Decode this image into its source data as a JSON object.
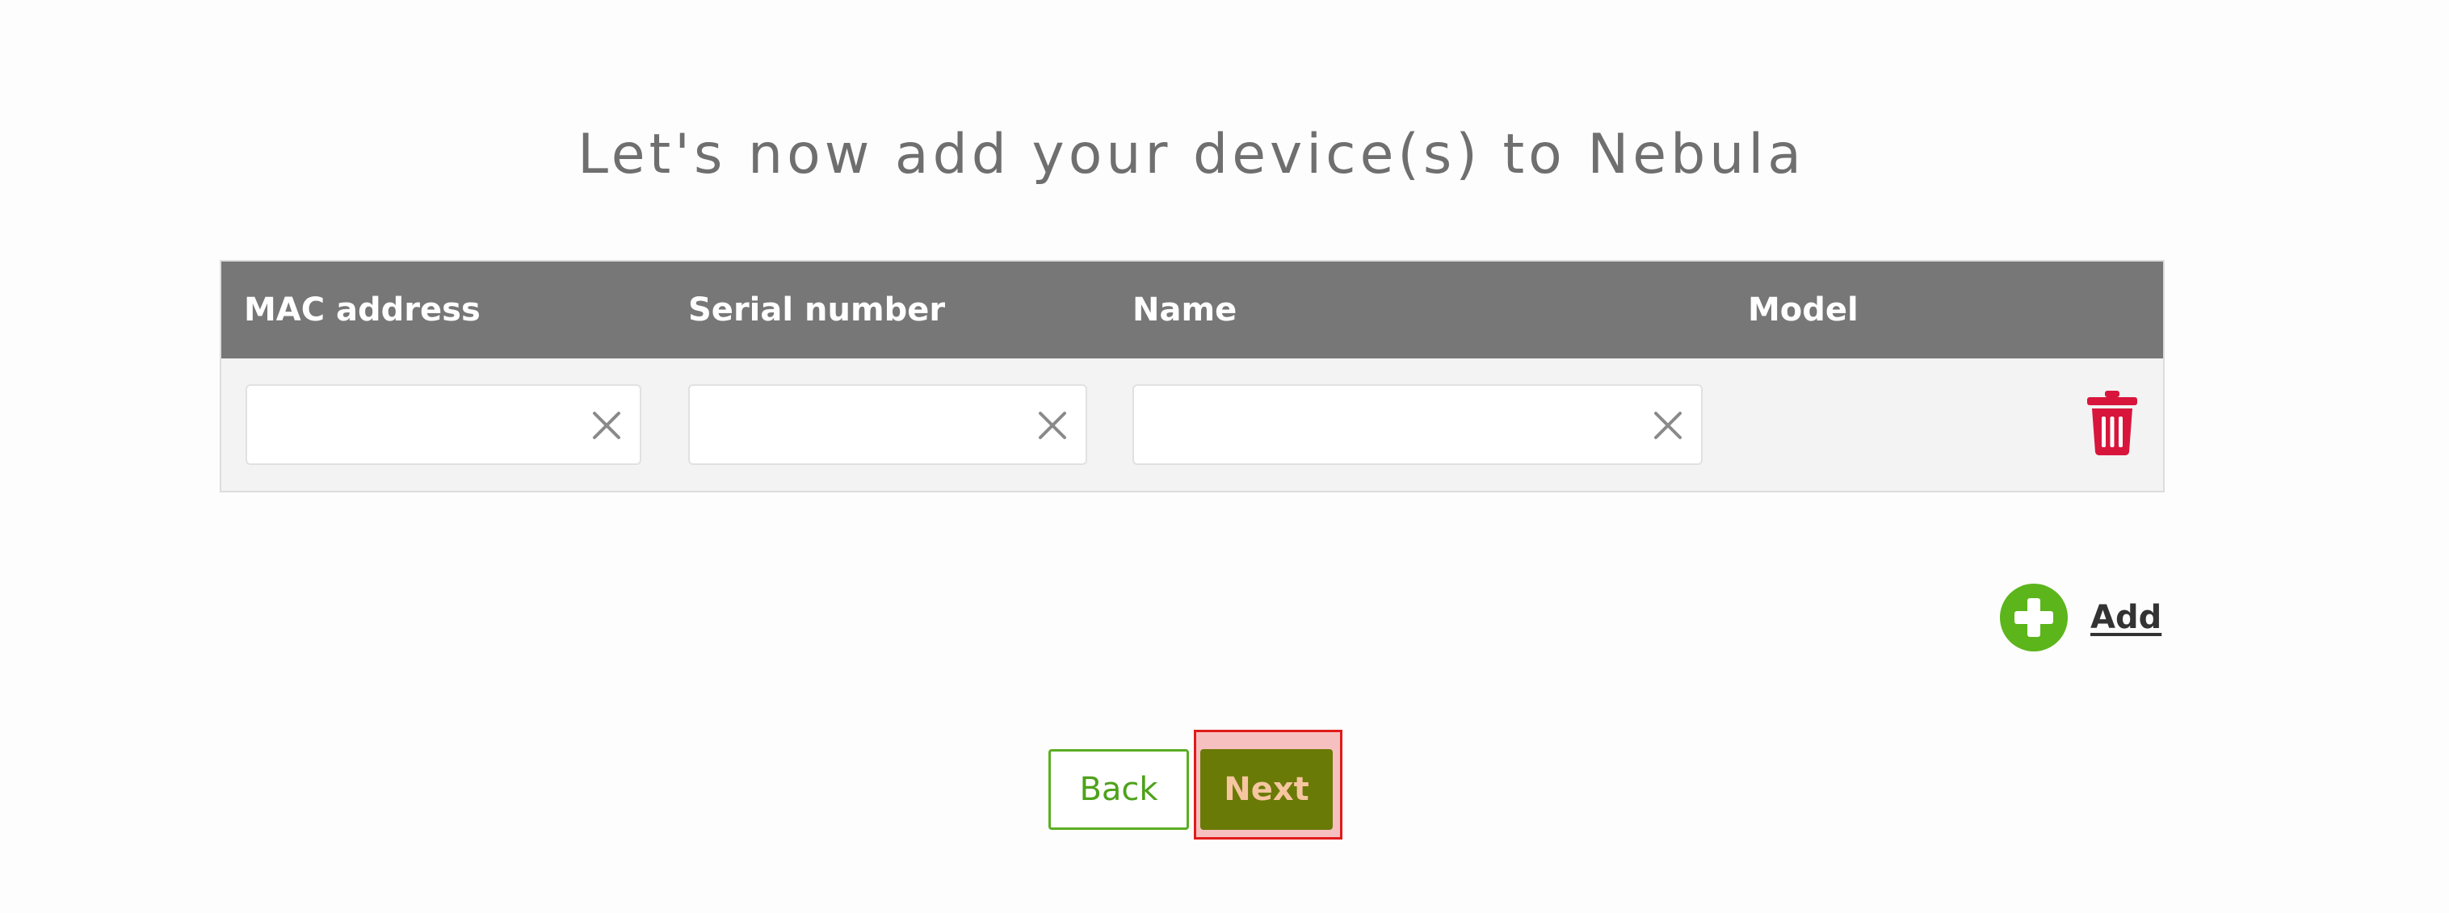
{
  "page": {
    "title": "Let's now add your device(s) to Nebula"
  },
  "table": {
    "columns": {
      "mac": "MAC address",
      "serial": "Serial number",
      "name": "Name",
      "model": "Model"
    },
    "row": {
      "mac_value": "",
      "serial_value": "",
      "name_value": "",
      "model_value": ""
    }
  },
  "actions": {
    "add_label": "Add",
    "back_label": "Back",
    "next_label": "Next"
  },
  "icons": {
    "clear": "close-icon",
    "delete": "trash-icon",
    "add": "plus-circle-icon"
  },
  "colors": {
    "header_bg": "#777777",
    "delete_red": "#d8163c",
    "add_green": "#5cb51b",
    "back_green": "#4ea21b",
    "next_bg": "#6a7a06",
    "next_text": "#f6c6a0",
    "highlight_border": "#e01b1b",
    "highlight_fill": "#f7c0c0"
  }
}
